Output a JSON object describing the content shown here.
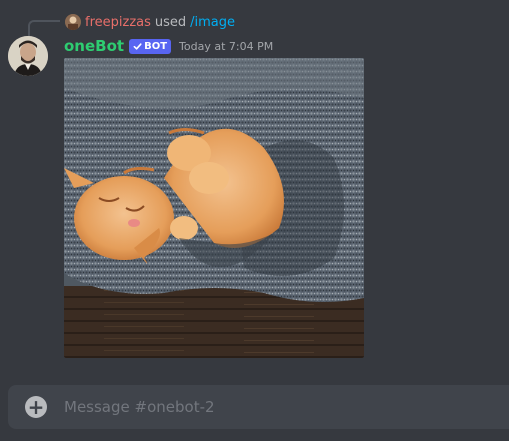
{
  "reply": {
    "username": "freepizzas",
    "used_text": "used",
    "command": "/image"
  },
  "message": {
    "username": "oneBot",
    "bot_tag": "BOT",
    "timestamp": "Today at 7:04 PM"
  },
  "composer": {
    "placeholder": "Message #onebot-2"
  },
  "colors": {
    "background": "#36393f",
    "username": "#2ecc71",
    "reply_user": "#e86f6a",
    "command_link": "#00aff4",
    "bot_tag": "#5865f2",
    "composer_bg": "#40444b"
  },
  "icons": {
    "add": "plus-circle-icon",
    "verified": "checkmark-icon"
  }
}
